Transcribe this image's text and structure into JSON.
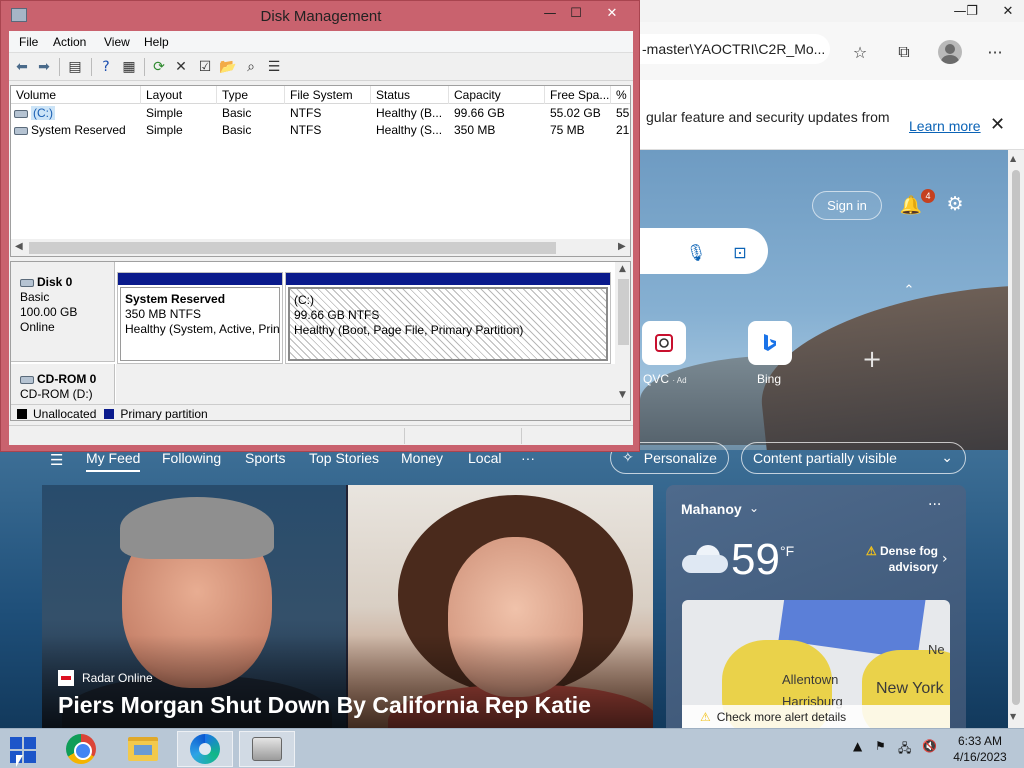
{
  "edge": {
    "address_fragment": "-master\\YAOCTRI\\C2R_Mo...",
    "infobar_text": "gular feature and security updates from",
    "infobar_link": "Learn more",
    "signin_label": "Sign in",
    "notification_count": "4",
    "tiles": [
      {
        "label": "QVC",
        "ad_label": "· Ad"
      },
      {
        "label": "Bing"
      }
    ],
    "feed_tabs": [
      "My Feed",
      "Following",
      "Sports",
      "Top Stories",
      "Money",
      "Local",
      "···"
    ],
    "personalize_label": "Personalize",
    "content_visibility_label": "Content partially visible",
    "news": {
      "source": "Radar Online",
      "headline": "Piers Morgan Shut Down By California Rep Katie"
    },
    "weather": {
      "location": "Mahanoy",
      "temperature": "59",
      "unit": "°F",
      "alert_line1": "Dense fog",
      "alert_line2": "advisory",
      "map_cities": [
        "Allentown",
        "New York",
        "Harrisburg",
        "Ne"
      ],
      "map_alert": "Check more alert details"
    }
  },
  "disk_mgmt": {
    "title": "Disk Management",
    "menu": [
      "File",
      "Action",
      "View",
      "Help"
    ],
    "columns": [
      "Volume",
      "Layout",
      "Type",
      "File System",
      "Status",
      "Capacity",
      "Free Spa...",
      "% F"
    ],
    "volumes": [
      {
        "volume": "(C:)",
        "layout": "Simple",
        "type": "Basic",
        "fs": "NTFS",
        "status": "Healthy (B...",
        "capacity": "99.66 GB",
        "free": "55.02 GB",
        "pct": "55"
      },
      {
        "volume": "System Reserved",
        "layout": "Simple",
        "type": "Basic",
        "fs": "NTFS",
        "status": "Healthy (S...",
        "capacity": "350 MB",
        "free": "75 MB",
        "pct": "21"
      }
    ],
    "disk0": {
      "name": "Disk 0",
      "type": "Basic",
      "size": "100.00 GB",
      "state": "Online"
    },
    "partitions": [
      {
        "name": "System Reserved",
        "size": "350 MB NTFS",
        "status": "Healthy (System, Active, Prin"
      },
      {
        "name": "(C:)",
        "size": "99.66 GB NTFS",
        "status": "Healthy (Boot, Page File, Primary Partition)"
      }
    ],
    "cdrom": {
      "name": "CD-ROM 0",
      "detail": "CD-ROM (D:)"
    },
    "legend": [
      {
        "label": "Unallocated",
        "color": "#000000"
      },
      {
        "label": "Primary partition",
        "color": "#0a1a8c"
      }
    ]
  },
  "taskbar": {
    "time": "6:33 AM",
    "date": "4/16/2023"
  }
}
